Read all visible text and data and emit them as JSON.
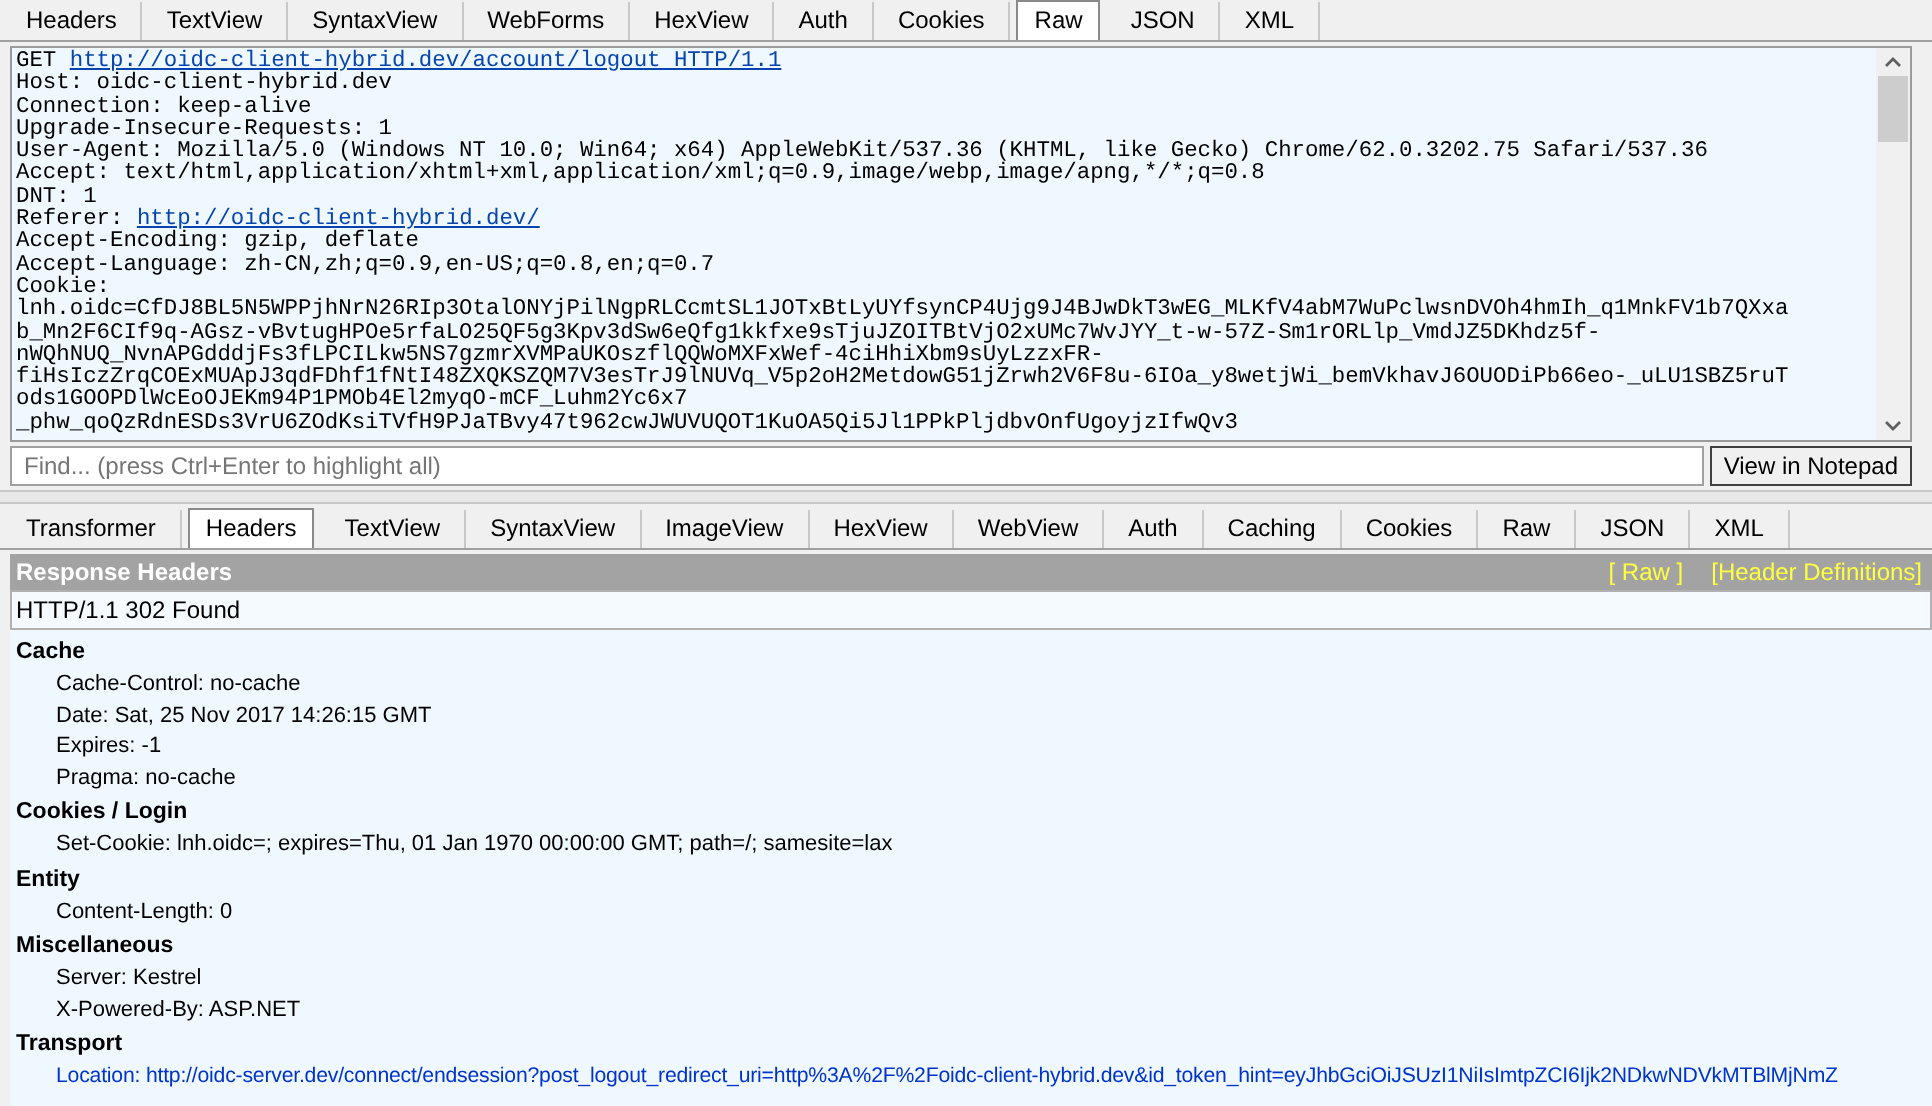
{
  "request_tabs": [
    {
      "label": "Headers",
      "selected": false
    },
    {
      "label": "TextView",
      "selected": false
    },
    {
      "label": "SyntaxView",
      "selected": false
    },
    {
      "label": "WebForms",
      "selected": false
    },
    {
      "label": "HexView",
      "selected": false
    },
    {
      "label": "Auth",
      "selected": false
    },
    {
      "label": "Cookies",
      "selected": false
    },
    {
      "label": "Raw",
      "selected": true
    },
    {
      "label": "JSON",
      "selected": false
    },
    {
      "label": "XML",
      "selected": false
    }
  ],
  "raw_request": {
    "lines": [
      {
        "text": "GET ",
        "link": "http://oidc-client-hybrid.dev/account/logout HTTP/1.1"
      },
      {
        "text": "Host: oidc-client-hybrid.dev"
      },
      {
        "text": "Connection: keep-alive"
      },
      {
        "text": "Upgrade-Insecure-Requests: 1"
      },
      {
        "text": "User-Agent: Mozilla/5.0 (Windows NT 10.0; Win64; x64) AppleWebKit/537.36 (KHTML, like Gecko) Chrome/62.0.3202.75 Safari/537.36"
      },
      {
        "text": "Accept: text/html,application/xhtml+xml,application/xml;q=0.9,image/webp,image/apng,*/*;q=0.8"
      },
      {
        "text": "DNT: 1"
      },
      {
        "text": "Referer: ",
        "link": "http://oidc-client-hybrid.dev/"
      },
      {
        "text": "Accept-Encoding: gzip, deflate"
      },
      {
        "text": "Accept-Language: zh-CN,zh;q=0.9,en-US;q=0.8,en;q=0.7"
      },
      {
        "text": "Cookie:"
      },
      {
        "text": "lnh.oidc=CfDJ8BL5N5WPPjhNrN26RIp3OtalONYjPilNgpRLCcmtSL1JOTxBtLyUYfsynCP4Ujg9J4BJwDkT3wEG_MLKfV4abM7WuPclwsnDVOh4hmIh_q1MnkFV1b7QXxa"
      },
      {
        "text": "b_Mn2F6CIf9q-AGsz-vBvtugHPOe5rfaLO25QF5g3Kpv3dSw6eQfg1kkfxe9sTjuJZOITBtVjO2xUMc7WvJYY_t-w-57Z-Sm1rORLlp_VmdJZ5DKhdz5f-"
      },
      {
        "text": "nWQhNUQ_NvnAPGdddjFs3fLPCILkw5NS7gzmrXVMPaUKOszflQQWoMXFxWef-4ciHhiXbm9sUyLzzxFR-"
      },
      {
        "text": "fiHsIczZrqCOExMUApJ3qdFDhf1fNtI48ZXQKSZQM7V3esTrJ9lNUVq_V5p2oH2MetdowG51jZrwh2V6F8u-6IOa_y8wetjWi_bemVkhavJ6OUODiPb66eo-_uLU1SBZ5ruT"
      },
      {
        "text": "ods1GOOPDlWcEoOJEKm94P1PMOb4El2myqO-mCF_Luhm2Yc6x7"
      },
      {
        "text": "_phw_qoQzRdnESDs3VrU6ZOdKsiTVfH9PJaTBvy47t962cwJWUVUQOT1KuOA5Qi5Jl1PPkPljdbvOnfUgoyjzIfwQv3"
      }
    ]
  },
  "find": {
    "placeholder": "Find... (press Ctrl+Enter to highlight all)",
    "button": "View in Notepad"
  },
  "response_tabs": [
    {
      "label": "Transformer",
      "selected": false
    },
    {
      "label": "Headers",
      "selected": true
    },
    {
      "label": "TextView",
      "selected": false
    },
    {
      "label": "SyntaxView",
      "selected": false
    },
    {
      "label": "ImageView",
      "selected": false
    },
    {
      "label": "HexView",
      "selected": false
    },
    {
      "label": "WebView",
      "selected": false
    },
    {
      "label": "Auth",
      "selected": false
    },
    {
      "label": "Caching",
      "selected": false
    },
    {
      "label": "Cookies",
      "selected": false
    },
    {
      "label": "Raw",
      "selected": false
    },
    {
      "label": "JSON",
      "selected": false
    },
    {
      "label": "XML",
      "selected": false
    }
  ],
  "response_headers": {
    "title": "Response Headers",
    "links": [
      "[ Raw ]",
      "[Header Definitions]"
    ],
    "status_line": "HTTP/1.1 302 Found",
    "groups": [
      {
        "name": "Cache",
        "items": [
          {
            "text": "Cache-Control: no-cache",
            "kind": "plain"
          },
          {
            "text": "Date: Sat, 25 Nov 2017 14:26:15 GMT",
            "kind": "plain"
          },
          {
            "text": "Expires: -1",
            "kind": "plain"
          },
          {
            "text": "Pragma: no-cache",
            "kind": "plain"
          }
        ]
      },
      {
        "name": "Cookies / Login",
        "items": [
          {
            "text": "Set-Cookie: lnh.oidc=; expires=Thu, 01 Jan 1970 00:00:00 GMT; path=/; samesite=lax",
            "kind": "plain"
          }
        ]
      },
      {
        "name": "Entity",
        "items": [
          {
            "text": "Content-Length: 0",
            "kind": "plain"
          }
        ]
      },
      {
        "name": "Miscellaneous",
        "items": [
          {
            "text": "Server: Kestrel",
            "kind": "plain"
          },
          {
            "text": "X-Powered-By: ASP.NET",
            "kind": "plain"
          }
        ]
      },
      {
        "name": "Transport",
        "items": [
          {
            "text": "Location: http://oidc-server.dev/connect/endsession?post_logout_redirect_uri=http%3A%2F%2Foidc-client-hybrid.dev&id_token_hint=eyJhbGciOiJSUzI1NiIsImtpZCI6Ijk2NDkwNDVkMTBlMjNmZ",
            "kind": "link"
          }
        ]
      }
    ]
  }
}
